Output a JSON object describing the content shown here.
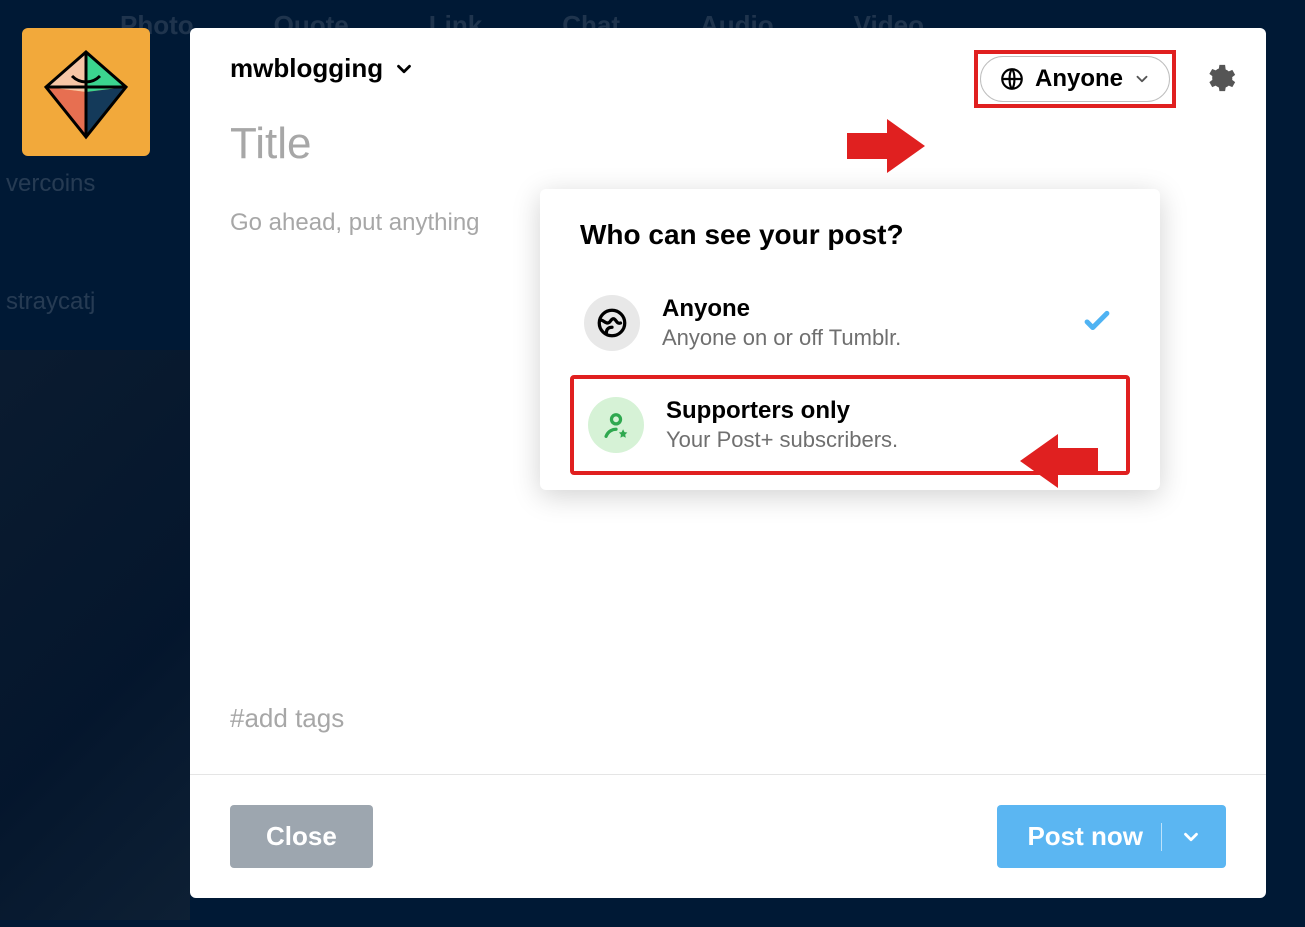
{
  "bg_nav": [
    "Photo",
    "Quote",
    "Link",
    "Chat",
    "Audio",
    "Video"
  ],
  "bg_side_1": "vercoins",
  "bg_side_2": "straycatj",
  "blog_name": "mwblogging",
  "audience_selected": "Anyone",
  "title_placeholder": "Title",
  "body_placeholder": "Go ahead, put anything",
  "tags_placeholder": "#add tags",
  "popover": {
    "heading": "Who can see your post?",
    "anyone": {
      "title": "Anyone",
      "subtitle": "Anyone on or off Tumblr."
    },
    "supporters": {
      "title": "Supporters only",
      "subtitle": "Your Post+ subscribers."
    }
  },
  "footer": {
    "close": "Close",
    "post": "Post now"
  }
}
